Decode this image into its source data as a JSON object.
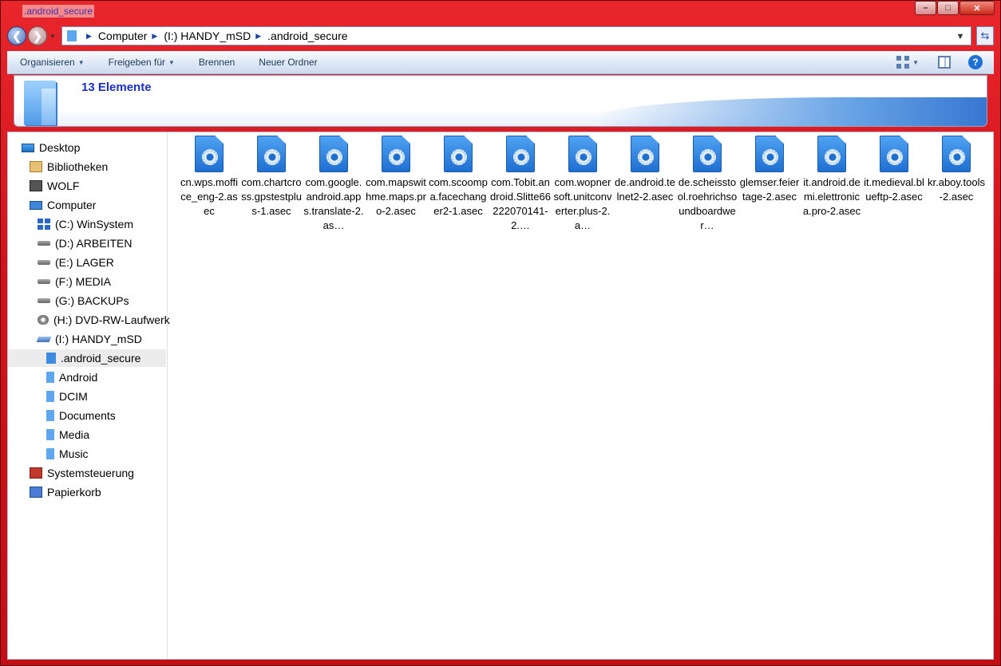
{
  "window": {
    "title": ".android_secure",
    "minimize": "–",
    "maximize": "□",
    "close": "✕"
  },
  "address": {
    "crumbs": [
      "Computer",
      "(I:) HANDY_mSD",
      ".android_secure"
    ]
  },
  "toolbar": {
    "organize": "Organisieren",
    "share": "Freigeben für",
    "burn": "Brennen",
    "new_folder": "Neuer Ordner"
  },
  "info": {
    "item_count": "13 Elemente"
  },
  "nav": {
    "desktop": "Desktop",
    "libraries": "Bibliotheken",
    "user": "WOLF",
    "computer": "Computer",
    "drives": [
      "(C:) WinSystem",
      "(D:) ARBEITEN",
      "(E:) LAGER",
      "(F:) MEDIA",
      "(G:) BACKUPs",
      "(H:) DVD-RW-Laufwerk",
      "(I:) HANDY_mSD"
    ],
    "folders": [
      ".android_secure",
      "Android",
      "DCIM",
      "Documents",
      "Media",
      "Music"
    ],
    "control_panel": "Systemsteuerung",
    "recycle_bin": "Papierkorb"
  },
  "files": [
    "cn.wps.moffice_eng-2.asec",
    "com.chartcross.gpstestplus-1.asec",
    "com.google.android.apps.translate-2.as…",
    "com.mapswithme.maps.pro-2.asec",
    "com.scoompa.facechanger2-1.asec",
    "com.Tobit.android.Slitte66222070141-2.…",
    "com.wopnersoft.unitconverter.plus-2.a…",
    "de.android.telnet2-2.asec",
    "de.scheisstool.roehrichsoundboardwer…",
    "glemser.feiertage-2.asec",
    "it.android.demi.elettronica.pro-2.asec",
    "it.medieval.blueftp-2.asec",
    "kr.aboy.tools-2.asec"
  ],
  "icons": {
    "back": "back-arrow-icon",
    "forward": "forward-arrow-icon",
    "refresh": "refresh-icon",
    "help": "help-icon"
  },
  "colors": {
    "window_frame": "#d3121a",
    "item_count": "#1a2fd0",
    "file_icon": "#1f6fd1"
  }
}
